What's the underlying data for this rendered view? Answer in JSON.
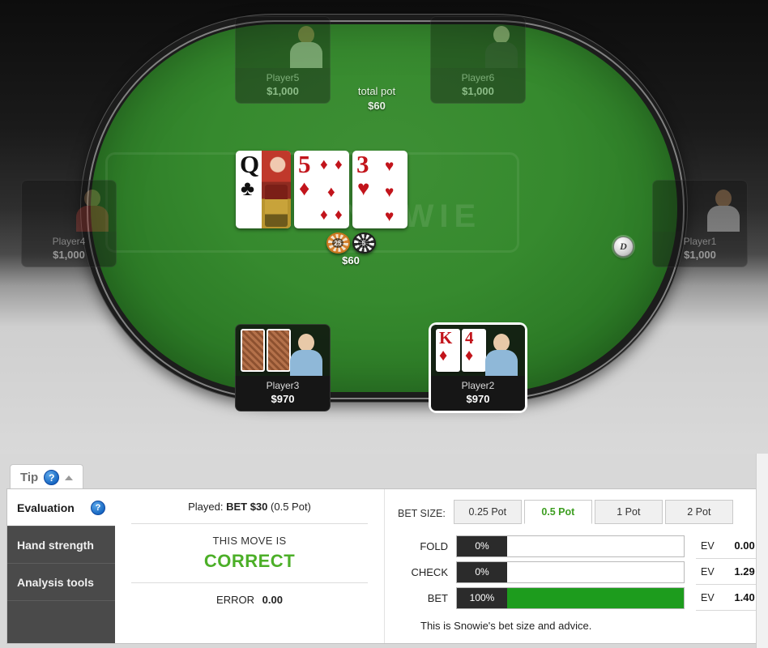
{
  "table": {
    "watermark": "SNOWIE",
    "total_pot_label": "total pot",
    "total_pot_amount": "$60",
    "pot_chips_amount": "$60",
    "dealer_button": "D",
    "chips": [
      {
        "denom": "25",
        "name": "chip-25"
      },
      {
        "denom": "5",
        "name": "chip-5"
      }
    ],
    "board_cards": [
      {
        "rank": "Q",
        "suit": "♣",
        "color": "black"
      },
      {
        "rank": "5",
        "suit": "♦",
        "color": "red"
      },
      {
        "rank": "3",
        "suit": "♥",
        "color": "red"
      }
    ],
    "seats": [
      {
        "name": "Player5",
        "stack": "$1,000",
        "state": "inactive"
      },
      {
        "name": "Player6",
        "stack": "$1,000",
        "state": "inactive"
      },
      {
        "name": "Player4",
        "stack": "$1,000",
        "state": "inactive"
      },
      {
        "name": "Player1",
        "stack": "$1,000",
        "state": "inactive"
      },
      {
        "name": "Player3",
        "stack": "$970",
        "state": "facedown"
      },
      {
        "name": "Player2",
        "stack": "$970",
        "state": "hero"
      }
    ],
    "hero_cards": [
      {
        "rank": "K",
        "suit": "♦",
        "color": "red"
      },
      {
        "rank": "4",
        "suit": "♦",
        "color": "red"
      }
    ]
  },
  "tipbar": {
    "label": "Tip",
    "help_icon": "?",
    "collapse_icon": "▲"
  },
  "side_tabs": [
    {
      "label": "Evaluation",
      "active": true,
      "help_icon": "?"
    },
    {
      "label": "Hand strength",
      "active": false
    },
    {
      "label": "Analysis tools",
      "active": false
    }
  ],
  "evaluation": {
    "played_prefix": "Played:",
    "played_action": "BET $30",
    "played_suffix": "(0.5 Pot)",
    "move_is": "THIS MOVE IS",
    "verdict": "CORRECT",
    "error_label": "ERROR",
    "error_value": "0.00"
  },
  "advice": {
    "bet_size_label": "BET SIZE:",
    "bet_size_tabs": [
      {
        "label": "0.25 Pot",
        "active": false
      },
      {
        "label": "0.5 Pot",
        "active": true
      },
      {
        "label": "1 Pot",
        "active": false
      },
      {
        "label": "2 Pot",
        "active": false
      }
    ],
    "actions": [
      {
        "name": "FOLD",
        "pct": "0%",
        "pct_value": 0,
        "ev_label": "EV",
        "ev": "0.00"
      },
      {
        "name": "CHECK",
        "pct": "0%",
        "pct_value": 0,
        "ev_label": "EV",
        "ev": "1.29"
      },
      {
        "name": "BET",
        "pct": "100%",
        "pct_value": 100,
        "ev_label": "EV",
        "ev": "1.40"
      }
    ],
    "footer": "This is Snowie's bet size and advice."
  },
  "colors": {
    "felt_green": "#368a2e",
    "accent_green": "#1d9c1d",
    "verdict_green": "#4caf28",
    "tab_dark": "#4a4a4a",
    "card_red": "#c2141b"
  }
}
